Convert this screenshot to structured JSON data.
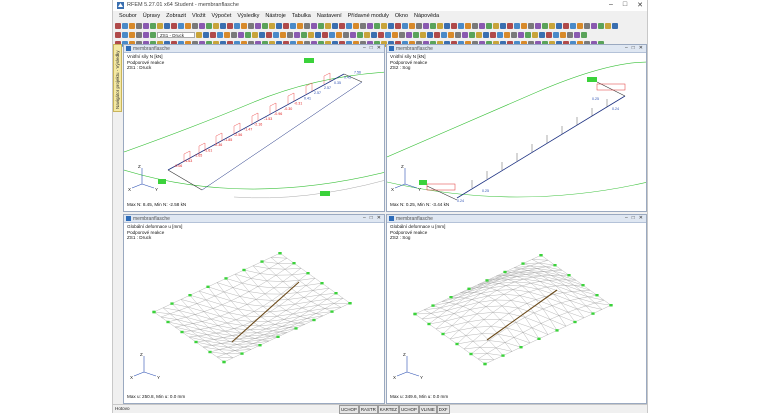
{
  "window": {
    "title": "RFEM 5.27.01 x64 Student - membranflasche"
  },
  "menu": [
    "Soubor",
    "Úpravy",
    "Zobrazit",
    "Vložit",
    "Výpočet",
    "Výsledky",
    "Nástroje",
    "Tabulka",
    "Nastavení",
    "Přídavné moduly",
    "Okno",
    "Nápověda"
  ],
  "toolbar": {
    "load_case_combo": "ZS1 - Druck"
  },
  "navigator_tab": "Navigátor projektu - Výsledky",
  "panes": [
    {
      "title": "membranflasche",
      "info": [
        "Vnitřní síly N [kN]",
        "Podporové reakce",
        "ZS1 : Druck"
      ],
      "footer": "Max N: 8.45, Min N: -2.58 kN",
      "labels": [
        "-0.06",
        "-1.63",
        "-1.65",
        "-1.61",
        "-2.36",
        "-1.85",
        "-2.56",
        "-1.47",
        "-2.16",
        "-1.53",
        "-0.96",
        "-0.30",
        "-0.31",
        "0.41",
        "2.57",
        "2.57",
        "0.35",
        "0.45",
        "7.56"
      ]
    },
    {
      "title": "membranflasche",
      "info": [
        "Vnitřní síly N [kN]",
        "Podporové reakce",
        "ZS2 : Sog"
      ],
      "footer": "Max N: 0.25, Min N: -3.44 kN",
      "labels": [
        "0.25",
        "0.24",
        "0.25",
        "0.24"
      ]
    },
    {
      "title": "membranflasche",
      "info": [
        "Globální deformace u [mm]",
        "Podporové reakce",
        "ZS1 : Druck"
      ],
      "footer": "Max u: 250.8, Min u: 0.0 mm",
      "labels": []
    },
    {
      "title": "membranflasche",
      "info": [
        "Globální deformace u [mm]",
        "Podporové reakce",
        "ZS2 : Sog"
      ],
      "footer": "Max u: 349.6, Min u: 0.0 mm",
      "labels": []
    }
  ],
  "axis": {
    "x": "X",
    "y": "Y",
    "z": "Z"
  },
  "status": {
    "text": "Hotovo",
    "toggles": [
      "UCHOP",
      "RASTR",
      "KARTEZ",
      "UCHOP",
      "VLINIE",
      "DXF"
    ]
  },
  "colors": {
    "support": "#3bd23b",
    "load_curve": "#2b4fb3",
    "result_label": "#e02020",
    "mesh": "#9a9a9a"
  }
}
